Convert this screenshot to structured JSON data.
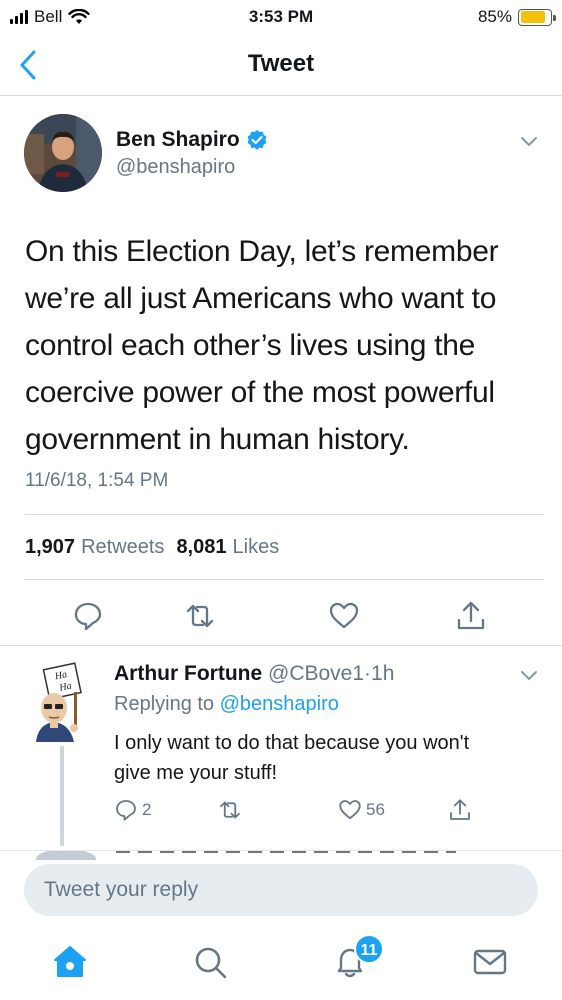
{
  "status_bar": {
    "carrier": "Bell",
    "time": "3:53 PM",
    "battery": "85%",
    "battery_level": 0.85
  },
  "nav": {
    "title": "Tweet",
    "back_icon": "chevron-left-icon"
  },
  "tweet": {
    "author_name": "Ben Shapiro",
    "author_handle": "@benshapiro",
    "verified": true,
    "lines": [
      "On this Election Day, let’s remember",
      "we’re all just Americans who want to",
      "control each other’s lives using the",
      "coercive power of the most powerful",
      "government in human history."
    ],
    "timestamp": "11/6/18, 1:54 PM",
    "retweets_count": "1,907",
    "retweets_label": "Retweets",
    "likes_count": "8,081",
    "likes_label": "Likes"
  },
  "reply": {
    "author_name": "Arthur Fortune",
    "author_handle": "@CBove1",
    "separator": "·",
    "age": "1h",
    "replying_label": "Replying to",
    "replying_to": "@benshapiro",
    "text_lines": [
      "I only want to do that because you won't",
      "give me your stuff!"
    ],
    "reply_count": "2",
    "like_count": "56",
    "avatar_sign": [
      "Ha",
      "Ha"
    ]
  },
  "compose": {
    "placeholder": "Tweet your reply"
  },
  "tab_bar": {
    "notifications_badge": "11"
  },
  "colors": {
    "accent": "#1da1f2",
    "secondary_text": "#657786",
    "divider": "#d8dde1"
  }
}
